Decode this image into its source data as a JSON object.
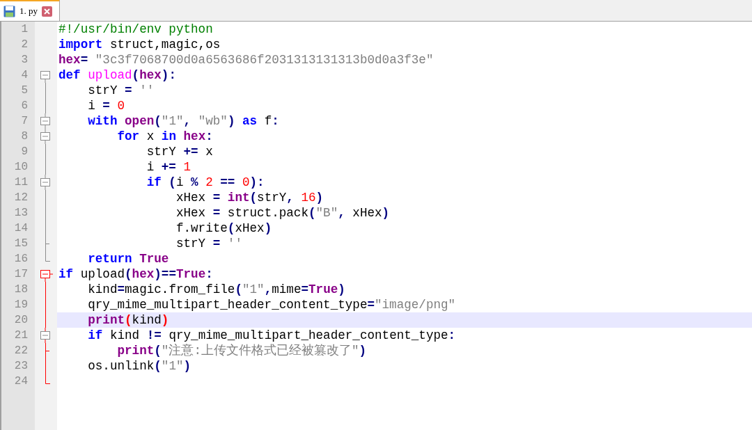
{
  "tab": {
    "label": "1. py",
    "selected": true
  },
  "lines": [
    {
      "number": "1",
      "selected": false,
      "tokens": [
        {
          "kind": "comment",
          "text": "#!/usr/bin/env python"
        }
      ]
    },
    {
      "number": "2",
      "selected": false,
      "tokens": [
        {
          "kind": "keyword",
          "text": "import"
        },
        {
          "kind": "plain",
          "text": " struct,magic,os"
        }
      ]
    },
    {
      "number": "3",
      "selected": false,
      "tokens": [
        {
          "kind": "builtin",
          "text": "hex"
        },
        {
          "kind": "operator",
          "text": "="
        },
        {
          "kind": "string",
          "text": " \"3c3f7068700d0a6563686f2031313131313b0d0a3f3e\""
        }
      ]
    },
    {
      "number": "4",
      "fold": {
        "kind": "open",
        "active": false
      },
      "selected": false,
      "tokens": [
        {
          "kind": "keyword",
          "text": "def"
        },
        {
          "kind": "defname",
          "text": " upload"
        },
        {
          "kind": "operator",
          "text": "("
        },
        {
          "kind": "builtin",
          "text": "hex"
        },
        {
          "kind": "operator",
          "text": "):"
        }
      ]
    },
    {
      "number": "5",
      "fold": {
        "kind": "line",
        "active": false
      },
      "selected": false,
      "tokens": [
        {
          "kind": "plain",
          "text": "    strY "
        },
        {
          "kind": "operator",
          "text": "="
        },
        {
          "kind": "string",
          "text": " ''"
        }
      ]
    },
    {
      "number": "6",
      "fold": {
        "kind": "line",
        "active": false
      },
      "selected": false,
      "tokens": [
        {
          "kind": "plain",
          "text": "    i "
        },
        {
          "kind": "operator",
          "text": "="
        },
        {
          "kind": "number",
          "text": " 0"
        }
      ]
    },
    {
      "number": "7",
      "fold": {
        "kind": "nested-open",
        "active": false
      },
      "selected": false,
      "tokens": [
        {
          "kind": "keyword",
          "text": "    with"
        },
        {
          "kind": "builtin",
          "text": " open"
        },
        {
          "kind": "operator",
          "text": "("
        },
        {
          "kind": "string",
          "text": "\"1\""
        },
        {
          "kind": "operator",
          "text": ","
        },
        {
          "kind": "string",
          "text": " \"wb\""
        },
        {
          "kind": "operator",
          "text": ")"
        },
        {
          "kind": "keyword",
          "text": " as"
        },
        {
          "kind": "plain",
          "text": " f"
        },
        {
          "kind": "operator",
          "text": ":"
        }
      ]
    },
    {
      "number": "8",
      "fold": {
        "kind": "nested-open",
        "active": false
      },
      "selected": false,
      "tokens": [
        {
          "kind": "keyword",
          "text": "        for"
        },
        {
          "kind": "plain",
          "text": " x "
        },
        {
          "kind": "keyword",
          "text": "in"
        },
        {
          "kind": "builtin",
          "text": " hex"
        },
        {
          "kind": "operator",
          "text": ":"
        }
      ]
    },
    {
      "number": "9",
      "fold": {
        "kind": "line",
        "active": false
      },
      "selected": false,
      "tokens": [
        {
          "kind": "plain",
          "text": "            strY "
        },
        {
          "kind": "operator",
          "text": "+="
        },
        {
          "kind": "plain",
          "text": " x"
        }
      ]
    },
    {
      "number": "10",
      "fold": {
        "kind": "line",
        "active": false
      },
      "selected": false,
      "tokens": [
        {
          "kind": "plain",
          "text": "            i "
        },
        {
          "kind": "operator",
          "text": "+="
        },
        {
          "kind": "number",
          "text": " 1"
        }
      ]
    },
    {
      "number": "11",
      "fold": {
        "kind": "nested-open",
        "active": false
      },
      "selected": false,
      "tokens": [
        {
          "kind": "keyword",
          "text": "            if"
        },
        {
          "kind": "operator",
          "text": " ("
        },
        {
          "kind": "plain",
          "text": "i "
        },
        {
          "kind": "operator",
          "text": "%"
        },
        {
          "kind": "number",
          "text": " 2"
        },
        {
          "kind": "operator",
          "text": " =="
        },
        {
          "kind": "number",
          "text": " 0"
        },
        {
          "kind": "operator",
          "text": "):"
        }
      ]
    },
    {
      "number": "12",
      "fold": {
        "kind": "line",
        "active": false
      },
      "selected": false,
      "tokens": [
        {
          "kind": "plain",
          "text": "                xHex "
        },
        {
          "kind": "operator",
          "text": "="
        },
        {
          "kind": "builtin",
          "text": " int"
        },
        {
          "kind": "operator",
          "text": "("
        },
        {
          "kind": "plain",
          "text": "strY"
        },
        {
          "kind": "operator",
          "text": ","
        },
        {
          "kind": "number",
          "text": " 16"
        },
        {
          "kind": "operator",
          "text": ")"
        }
      ]
    },
    {
      "number": "13",
      "fold": {
        "kind": "line",
        "active": false
      },
      "selected": false,
      "tokens": [
        {
          "kind": "plain",
          "text": "                xHex "
        },
        {
          "kind": "operator",
          "text": "="
        },
        {
          "kind": "plain",
          "text": " struct.pack"
        },
        {
          "kind": "operator",
          "text": "("
        },
        {
          "kind": "string",
          "text": "\"B\""
        },
        {
          "kind": "operator",
          "text": ","
        },
        {
          "kind": "plain",
          "text": " xHex"
        },
        {
          "kind": "operator",
          "text": ")"
        }
      ]
    },
    {
      "number": "14",
      "fold": {
        "kind": "line",
        "active": false
      },
      "selected": false,
      "tokens": [
        {
          "kind": "plain",
          "text": "                f.write"
        },
        {
          "kind": "operator",
          "text": "("
        },
        {
          "kind": "plain",
          "text": "xHex"
        },
        {
          "kind": "operator",
          "text": ")"
        }
      ]
    },
    {
      "number": "15",
      "fold": {
        "kind": "tick",
        "active": false
      },
      "selected": false,
      "tokens": [
        {
          "kind": "plain",
          "text": "                strY "
        },
        {
          "kind": "operator",
          "text": "="
        },
        {
          "kind": "string",
          "text": " ''"
        }
      ]
    },
    {
      "number": "16",
      "fold": {
        "kind": "end",
        "active": false
      },
      "selected": false,
      "tokens": [
        {
          "kind": "keyword",
          "text": "    return"
        },
        {
          "kind": "builtin",
          "text": " True"
        }
      ]
    },
    {
      "number": "17",
      "fold": {
        "kind": "open",
        "active": true
      },
      "selected": false,
      "tokens": [
        {
          "kind": "keyword",
          "text": "if"
        },
        {
          "kind": "plain",
          "text": " upload"
        },
        {
          "kind": "operator",
          "text": "("
        },
        {
          "kind": "builtin",
          "text": "hex"
        },
        {
          "kind": "operator",
          "text": ")=="
        },
        {
          "kind": "builtin",
          "text": "True"
        },
        {
          "kind": "operator",
          "text": ":"
        }
      ]
    },
    {
      "number": "18",
      "fold": {
        "kind": "line",
        "active": true
      },
      "selected": false,
      "tokens": [
        {
          "kind": "plain",
          "text": "    kind"
        },
        {
          "kind": "operator",
          "text": "="
        },
        {
          "kind": "plain",
          "text": "magic.from_file"
        },
        {
          "kind": "operator",
          "text": "("
        },
        {
          "kind": "string",
          "text": "\"1\""
        },
        {
          "kind": "operator",
          "text": ","
        },
        {
          "kind": "plain",
          "text": "mime"
        },
        {
          "kind": "operator",
          "text": "="
        },
        {
          "kind": "builtin",
          "text": "True"
        },
        {
          "kind": "operator",
          "text": ")"
        }
      ]
    },
    {
      "number": "19",
      "fold": {
        "kind": "line",
        "active": true
      },
      "selected": false,
      "tokens": [
        {
          "kind": "plain",
          "text": "    qry_mime_multipart_header_content_type"
        },
        {
          "kind": "operator",
          "text": "="
        },
        {
          "kind": "string",
          "text": "\"image/png\""
        }
      ]
    },
    {
      "number": "20",
      "fold": {
        "kind": "line",
        "active": true
      },
      "selected": true,
      "tokens": [
        {
          "kind": "builtin",
          "text": "    print"
        },
        {
          "kind": "brace",
          "text": "("
        },
        {
          "kind": "plain",
          "text": "kind"
        },
        {
          "kind": "brace",
          "text": ")"
        }
      ]
    },
    {
      "number": "21",
      "fold": {
        "kind": "nested-open",
        "active": true
      },
      "selected": false,
      "tokens": [
        {
          "kind": "keyword",
          "text": "    if"
        },
        {
          "kind": "plain",
          "text": " kind "
        },
        {
          "kind": "operator",
          "text": "!="
        },
        {
          "kind": "plain",
          "text": " qry_mime_multipart_header_content_type"
        },
        {
          "kind": "operator",
          "text": ":"
        }
      ]
    },
    {
      "number": "22",
      "fold": {
        "kind": "tick",
        "active": true
      },
      "selected": false,
      "tokens": [
        {
          "kind": "builtin",
          "text": "        print"
        },
        {
          "kind": "operator",
          "text": "("
        },
        {
          "kind": "string",
          "text": "\"注意:上传文件格式已经被篡改了\""
        },
        {
          "kind": "operator",
          "text": ")"
        }
      ]
    },
    {
      "number": "23",
      "fold": {
        "kind": "line",
        "active": true
      },
      "selected": false,
      "tokens": [
        {
          "kind": "plain",
          "text": "    os.unlink"
        },
        {
          "kind": "operator",
          "text": "("
        },
        {
          "kind": "string",
          "text": "\"1\""
        },
        {
          "kind": "operator",
          "text": ")"
        }
      ]
    },
    {
      "number": "24",
      "fold": {
        "kind": "end",
        "active": true
      },
      "selected": false
    }
  ]
}
